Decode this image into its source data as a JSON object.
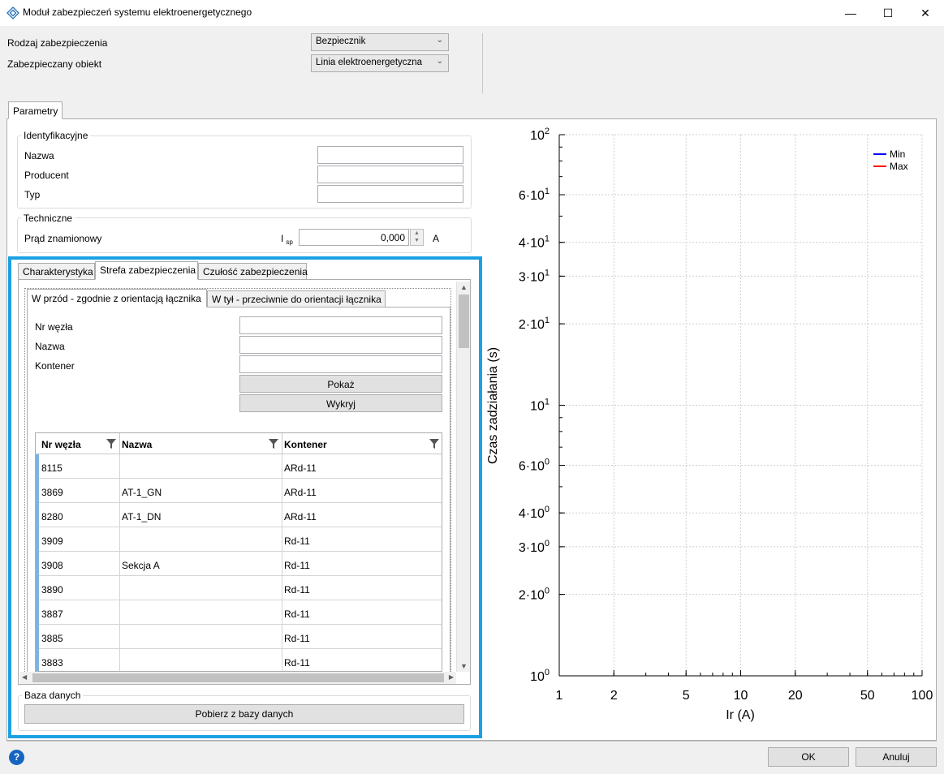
{
  "window": {
    "title": "Moduł zabezpieczeń systemu elektroenergetycznego",
    "minimize": "—",
    "maximize": "☐",
    "close": "✕"
  },
  "top": {
    "protection_type_label": "Rodzaj zabezpieczenia",
    "protection_type_value": "Bezpiecznik",
    "protected_object_label": "Zabezpieczany obiekt",
    "protected_object_value": "Linia elektroenergetyczna"
  },
  "tabs": {
    "parameters": "Parametry"
  },
  "identification": {
    "title": "Identyfikacyjne",
    "name_label": "Nazwa",
    "name_value": "",
    "producer_label": "Producent",
    "producer_value": "",
    "type_label": "Typ",
    "type_value": ""
  },
  "technical": {
    "title": "Techniczne",
    "rated_current_label": "Prąd znamionowy",
    "symbol_main": "I",
    "symbol_sub": "sp",
    "value": "0,000",
    "unit": "A"
  },
  "inner_tabs": {
    "characteristic": "Charakterystyka",
    "zone": "Strefa zabezpieczenia",
    "sensitivity": "Czułość zabezpieczenia"
  },
  "direction_tabs": {
    "forward": "W przód - zgodnie z orientacją łącznika",
    "backward": "W tył - przeciwnie do orientacji łącznika"
  },
  "search": {
    "node_label": "Nr węzła",
    "node_value": "",
    "name_label": "Nazwa",
    "name_value": "",
    "container_label": "Kontener",
    "container_value": "",
    "show_button": "Pokaż",
    "detect_button": "Wykryj"
  },
  "table": {
    "columns": [
      "Nr węzła",
      "Nazwa",
      "Kontener"
    ],
    "rows": [
      [
        "8115",
        "",
        "ARd-11"
      ],
      [
        "3869",
        "AT-1_GN",
        "ARd-11"
      ],
      [
        "8280",
        "AT-1_DN",
        "ARd-11"
      ],
      [
        "3909",
        "",
        "Rd-11"
      ],
      [
        "3908",
        "Sekcja A",
        "Rd-11"
      ],
      [
        "3890",
        "",
        "Rd-11"
      ],
      [
        "3887",
        "",
        "Rd-11"
      ],
      [
        "3885",
        "",
        "Rd-11"
      ],
      [
        "3883",
        "",
        "Rd-11"
      ]
    ]
  },
  "database": {
    "title": "Baza danych",
    "fetch_button": "Pobierz z bazy danych"
  },
  "footer": {
    "help": "?",
    "ok": "OK",
    "cancel": "Anuluj"
  },
  "colors": {
    "highlight_border": "#1ba1e2",
    "series_min": "#0000ff",
    "series_max": "#ff0000"
  },
  "chart_data": {
    "type": "line",
    "title": "",
    "xlabel": "Ir (A)",
    "ylabel": "Czas zadziałania (s)",
    "x_scale": "log",
    "y_scale": "log",
    "xlim": [
      1,
      100
    ],
    "ylim": [
      1,
      100
    ],
    "x_ticks": [
      1,
      2,
      5,
      10,
      20,
      50,
      100
    ],
    "x_tick_labels": [
      "1",
      "2",
      "5",
      "10",
      "20",
      "50",
      "100"
    ],
    "y_ticks": [
      1,
      2,
      3,
      4,
      6,
      10,
      20,
      30,
      40,
      60,
      100
    ],
    "y_tick_labels": [
      {
        "base": "10",
        "exp": "0"
      },
      {
        "base": "2·10",
        "exp": "0"
      },
      {
        "base": "3·10",
        "exp": "0"
      },
      {
        "base": "4·10",
        "exp": "0"
      },
      {
        "base": "6·10",
        "exp": "0"
      },
      {
        "base": "10",
        "exp": "1"
      },
      {
        "base": "2·10",
        "exp": "1"
      },
      {
        "base": "3·10",
        "exp": "1"
      },
      {
        "base": "4·10",
        "exp": "1"
      },
      {
        "base": "6·10",
        "exp": "1"
      },
      {
        "base": "10",
        "exp": "2"
      }
    ],
    "grid": true,
    "legend_position": "top-right",
    "series": [
      {
        "name": "Min",
        "values": []
      },
      {
        "name": "Max",
        "values": []
      }
    ]
  }
}
